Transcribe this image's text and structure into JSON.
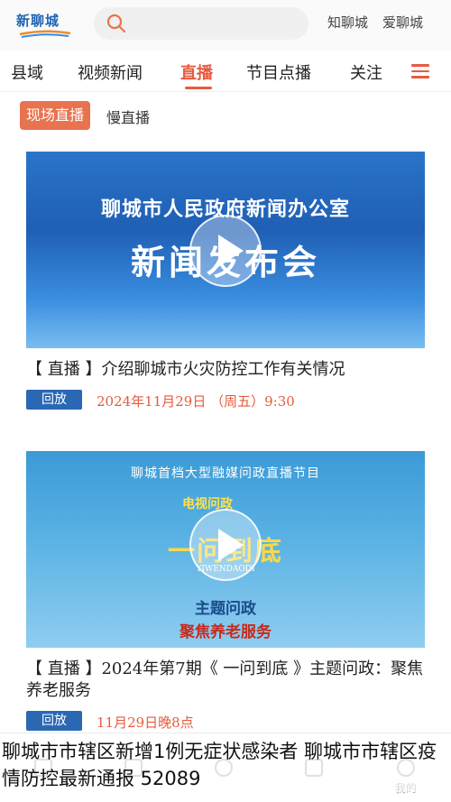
{
  "header": {
    "logo_text": "新聊城",
    "links": [
      "知聊城",
      "爱聊城"
    ]
  },
  "nav": {
    "tabs": [
      "县域",
      "视频新闻",
      "直播",
      "节目点播",
      "关注"
    ],
    "active_index": 2
  },
  "subtabs": {
    "active": "现场直播",
    "other": "慢直播"
  },
  "cards": [
    {
      "thumb_line1": "聊城市人民政府新闻办公室",
      "thumb_line2": "新闻发布会",
      "title": "【 直播 】介绍聊城市火灾防控工作有关情况",
      "badge": "回放",
      "time": "2024年11月29日 （周五）9:30"
    },
    {
      "thumb_line1": "聊城首档大型融媒问政直播节目",
      "thumb_brand": "电视问政",
      "thumb_main": "一问到底",
      "thumb_pinyin": "YIWENDAODI",
      "thumb_line2": "主题问政",
      "thumb_line3": "聚焦养老服务",
      "title": "【 直播 】2024年第7期《 一问到底 》主题问政：聚焦养老服务",
      "badge": "回放",
      "time": "11月29日晚8点"
    }
  ],
  "bottom_nav": {
    "right_label": "我的"
  },
  "overlay_caption": "聊城市市辖区新增1例无症状感染者  聊城市市辖区疫情防控最新通报  52089",
  "colors": {
    "accent": "#e85a3f",
    "badge_blue": "#2b68b4",
    "logo_blue": "#1f63b3"
  }
}
